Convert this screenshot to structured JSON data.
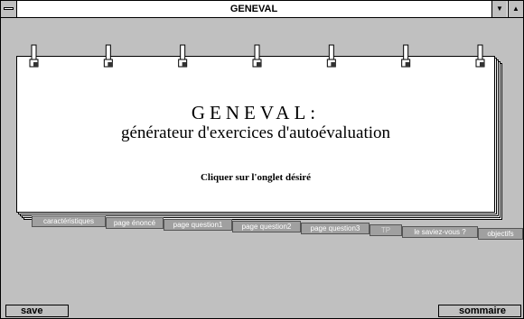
{
  "window": {
    "title": "GENEVAL",
    "minimize_glyph": "▼",
    "maximize_glyph": "▲"
  },
  "notebook": {
    "heading": "GENEVAL:",
    "subheading": "générateur d'exercices d'autoévaluation",
    "instruction": "Cliquer sur l'onglet désiré",
    "ring_count": 7
  },
  "tabs": [
    {
      "label": "caractéristiques",
      "enabled": true
    },
    {
      "label": "page énoncé",
      "enabled": true
    },
    {
      "label": "page question1",
      "enabled": true
    },
    {
      "label": "page question2",
      "enabled": true
    },
    {
      "label": "page question3",
      "enabled": true
    },
    {
      "label": "TP",
      "enabled": false
    },
    {
      "label": "le saviez-vous ?",
      "enabled": true
    },
    {
      "label": "objectifs",
      "enabled": true
    }
  ],
  "footer": {
    "save_label": "save",
    "sommaire_label": "sommaire"
  },
  "colors": {
    "window_bg": "#c0c0c0",
    "page_bg": "#ffffff",
    "tab_bg": "#a0a0a0",
    "tab_text": "#ffffff",
    "tab_disabled_text": "#d4d4d4"
  }
}
